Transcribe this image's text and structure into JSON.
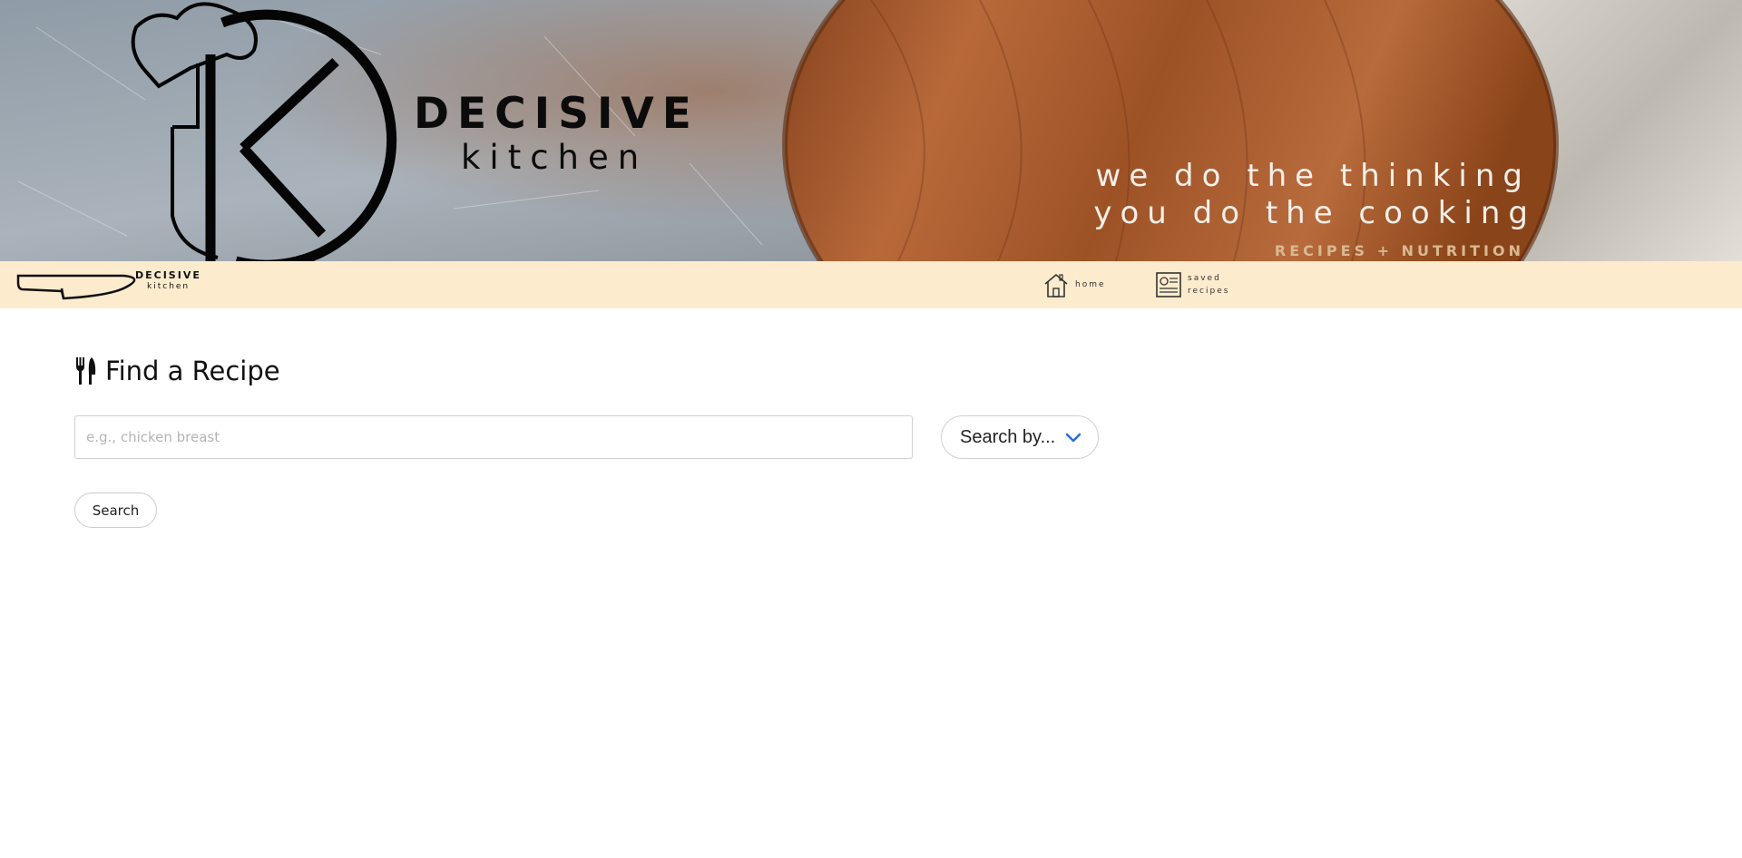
{
  "hero": {
    "brand_name": "DECISIVE",
    "brand_sub": "kitchen",
    "tagline_1": "we do the thinking",
    "tagline_2": "you do the cooking",
    "tagline_3": "RECIPES + NUTRITION"
  },
  "nav": {
    "logo_name": "DECISIVE",
    "logo_sub": "kitchen",
    "items": [
      {
        "label": "home",
        "icon": "house-icon"
      },
      {
        "label": "saved recipes",
        "icon": "recipe-card-icon"
      }
    ]
  },
  "main": {
    "title": "Find a Recipe",
    "title_icon": "utensils-icon",
    "search_placeholder": "e.g., chicken breast",
    "search_value": "",
    "select_label": "Search by...",
    "search_button": "Search"
  },
  "colors": {
    "navbar_bg": "#fdebcd",
    "chevron": "#2b6fd6"
  }
}
